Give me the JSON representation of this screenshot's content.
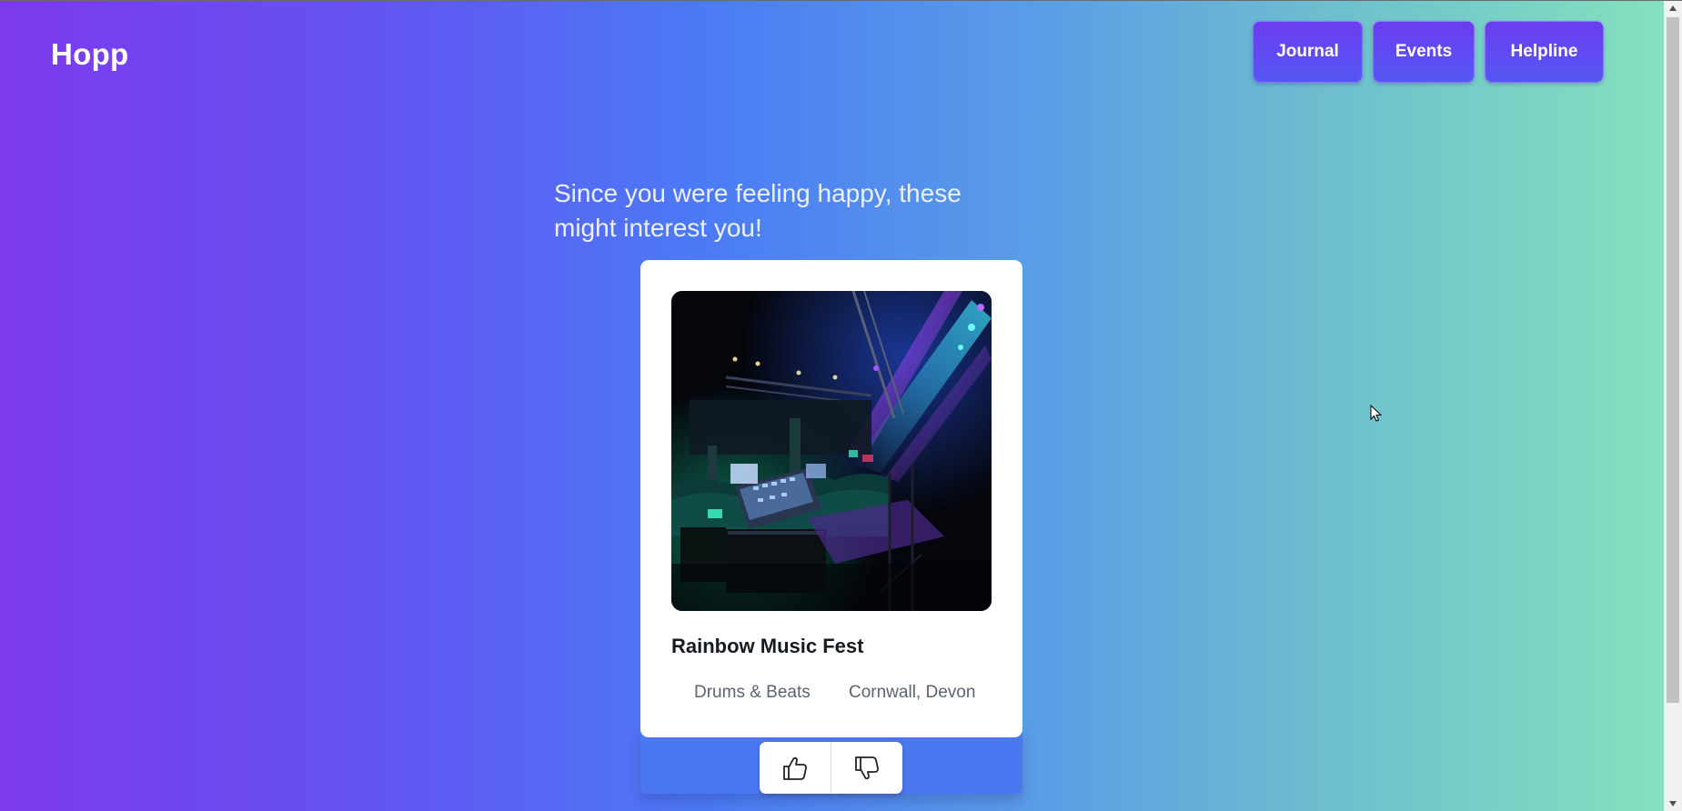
{
  "app": {
    "logo": "Hopp"
  },
  "nav": {
    "journal": "Journal",
    "events": "Events",
    "helpline": "Helpline"
  },
  "intro": "Since you were feeling happy, these might interest you!",
  "event": {
    "title": "Rainbow Music Fest",
    "genre": "Drums & Beats",
    "location": "Cornwall, Devon"
  },
  "icons": {
    "photo": "concert-stage-photo",
    "like": "thumbs-up-icon",
    "dislike": "thumbs-down-icon"
  },
  "colors": {
    "gradient_start": "#7c3aed",
    "gradient_mid": "#4b7bf5",
    "gradient_end": "#85e3bd",
    "nav_button": "#6047f2",
    "card": "#ffffff"
  }
}
